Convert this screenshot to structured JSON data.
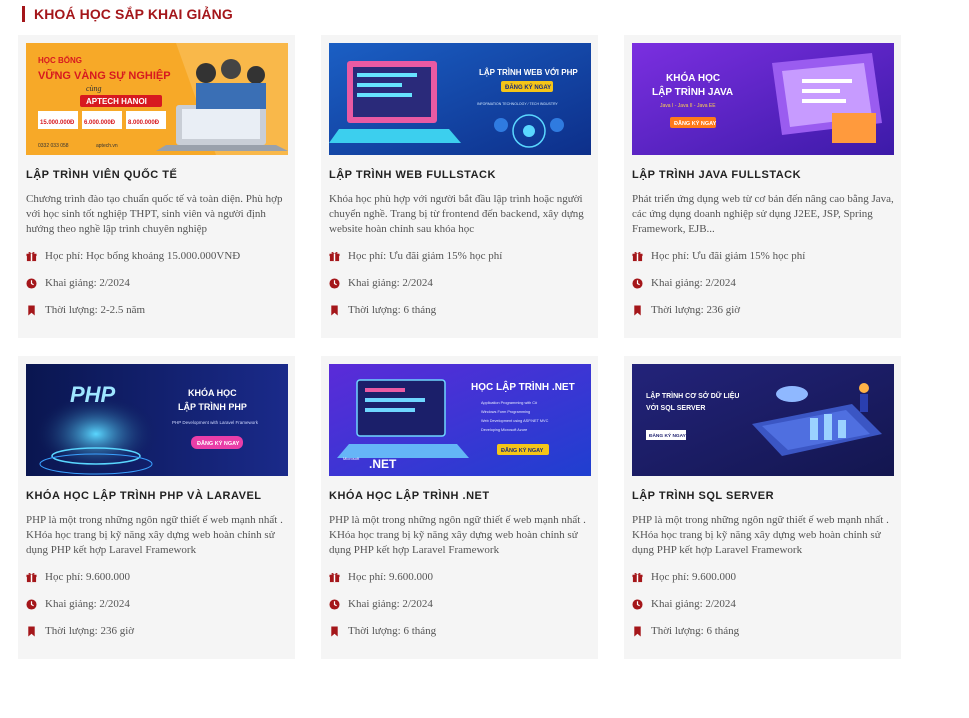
{
  "section": {
    "title": "KHOÁ HỌC SẮP KHAI GIẢNG"
  },
  "courses": [
    {
      "title": "LẬP TRÌNH VIÊN QUỐC TẾ",
      "description": "Chương trình đào tạo chuẩn quốc tế và toàn diện. Phù hợp với học sinh tốt nghiệp THPT, sinh viên và người định hướng theo nghề lập trình chuyên nghiệp",
      "fee": "Học phí: Học bổng khoảng 15.000.000VNĐ",
      "start": "Khai giảng: 2/2024",
      "duration": "Thời lượng: 2-2.5 năm",
      "banner": {
        "line1": "HỌC BỔNG",
        "line2": "VỮNG VÀNG SỰ NGHIỆP",
        "line3": "cùng",
        "line4": "APTECH HANOI",
        "amount1": "15.000.000Đ",
        "amount2": "6.000.000Đ",
        "amount3": "8.000.000Đ",
        "phone": "0332 033 058",
        "site": "aptech.vn",
        "colors": {
          "bg": "#f7a928",
          "accent": "#d71920"
        }
      }
    },
    {
      "title": "LẬP TRÌNH WEB FULLSTACK",
      "description": "Khóa học phù hợp với người bắt đầu lập trình hoặc người chuyển nghề. Trang bị từ frontend đến backend, xây dựng website hoàn chỉnh sau khóa học",
      "fee": "Học phí: Ưu đãi giảm 15% học phí",
      "start": "Khai giảng: 2/2024",
      "duration": "Thời lượng: 6 tháng",
      "banner": {
        "headline": "LẬP TRÌNH WEB VỚI PHP",
        "cta": "ĐĂNG KÝ NGAY",
        "tagline": "INFORMATION TECHNOLOGY / TECH INDUSTRY",
        "colors": {
          "bg": "#1f6fd1",
          "accent": "#f5c518"
        }
      }
    },
    {
      "title": "LẬP TRÌNH JAVA FULLSTACK",
      "description": "Phát triển ứng dụng web từ cơ bản đến nâng cao bằng Java, các ứng dụng doanh nghiệp sử dụng J2EE, JSP, Spring Framework, EJB...",
      "fee": "Học phí: Ưu đãi giảm 15% học phí",
      "start": "Khai giảng: 2/2024",
      "duration": "Thời lượng: 236 giờ",
      "banner": {
        "headline1": "KHÓA HỌC",
        "headline2": "LẬP TRÌNH JAVA",
        "sub": "Java I - Java II - Java EE",
        "cta": "ĐĂNG KÝ NGAY",
        "colors": {
          "bg": "#6a2bd1",
          "accent": "#ff7a1a"
        }
      }
    },
    {
      "title": "KHÓA HỌC LẬP TRÌNH PHP VÀ LARAVEL",
      "description": "PHP là một trong những ngôn ngữ thiết ế web mạnh nhất . KHóa học trang bị kỹ năng xây dựng web hoàn chỉnh sử dụng PHP kết hợp Laravel Framework",
      "fee": "Học phí: 9.600.000",
      "start": "Khai giảng: 2/2024",
      "duration": "Thời lượng: 236 giờ",
      "banner": {
        "logo": "PHP",
        "headline1": "KHÓA HỌC",
        "headline2": "LẬP TRÌNH PHP",
        "sub": "PHP Development with Laravel Framework",
        "cta": "ĐĂNG KÝ NGAY",
        "colors": {
          "bg": "#0f1a5c",
          "accent": "#e93ea8"
        }
      }
    },
    {
      "title": "KHÓA HỌC LẬP TRÌNH .NET",
      "description": "PHP là một trong những ngôn ngữ thiết ế web mạnh nhất . KHóa học trang bị kỹ năng xây dựng web hoàn chỉnh sử dụng PHP kết hợp Laravel Framework",
      "fee": "Học phí: 9.600.000",
      "start": "Khai giảng: 2/2024",
      "duration": "Thời lượng: 6 tháng",
      "banner": {
        "headline": "HỌC LẬP TRÌNH .NET",
        "items": [
          "Application Programming with C#",
          "Windows Form Programming",
          "Web Development using ASP.NET MVC",
          "Developing Microsoft Azure"
        ],
        "logo_small": "Microsoft",
        "logo": ".NET",
        "cta": "ĐĂNG KÝ NGAY",
        "colors": {
          "bg": "#3a2bd6",
          "accent": "#f5c518"
        }
      }
    },
    {
      "title": "LẬP TRÌNH SQL SERVER",
      "description": "PHP là một trong những ngôn ngữ thiết ế web mạnh nhất . KHóa học trang bị kỹ năng xây dựng web hoàn chỉnh sử dụng PHP kết hợp Laravel Framework",
      "fee": "Học phí: 9.600.000",
      "start": "Khai giảng: 2/2024",
      "duration": "Thời lượng: 6 tháng",
      "banner": {
        "headline1": "LẬP TRÌNH CƠ SỞ DỮ LIỆU",
        "headline2": "VỚI SQL SERVER",
        "cta": "ĐĂNG KÝ NGAY",
        "colors": {
          "bg": "#1d1f6e",
          "accent": "#ffffff"
        }
      }
    }
  ],
  "icons": {
    "fee": "gift-icon",
    "start": "clock-icon",
    "duration": "bookmark-icon",
    "color": "#a4161a"
  }
}
